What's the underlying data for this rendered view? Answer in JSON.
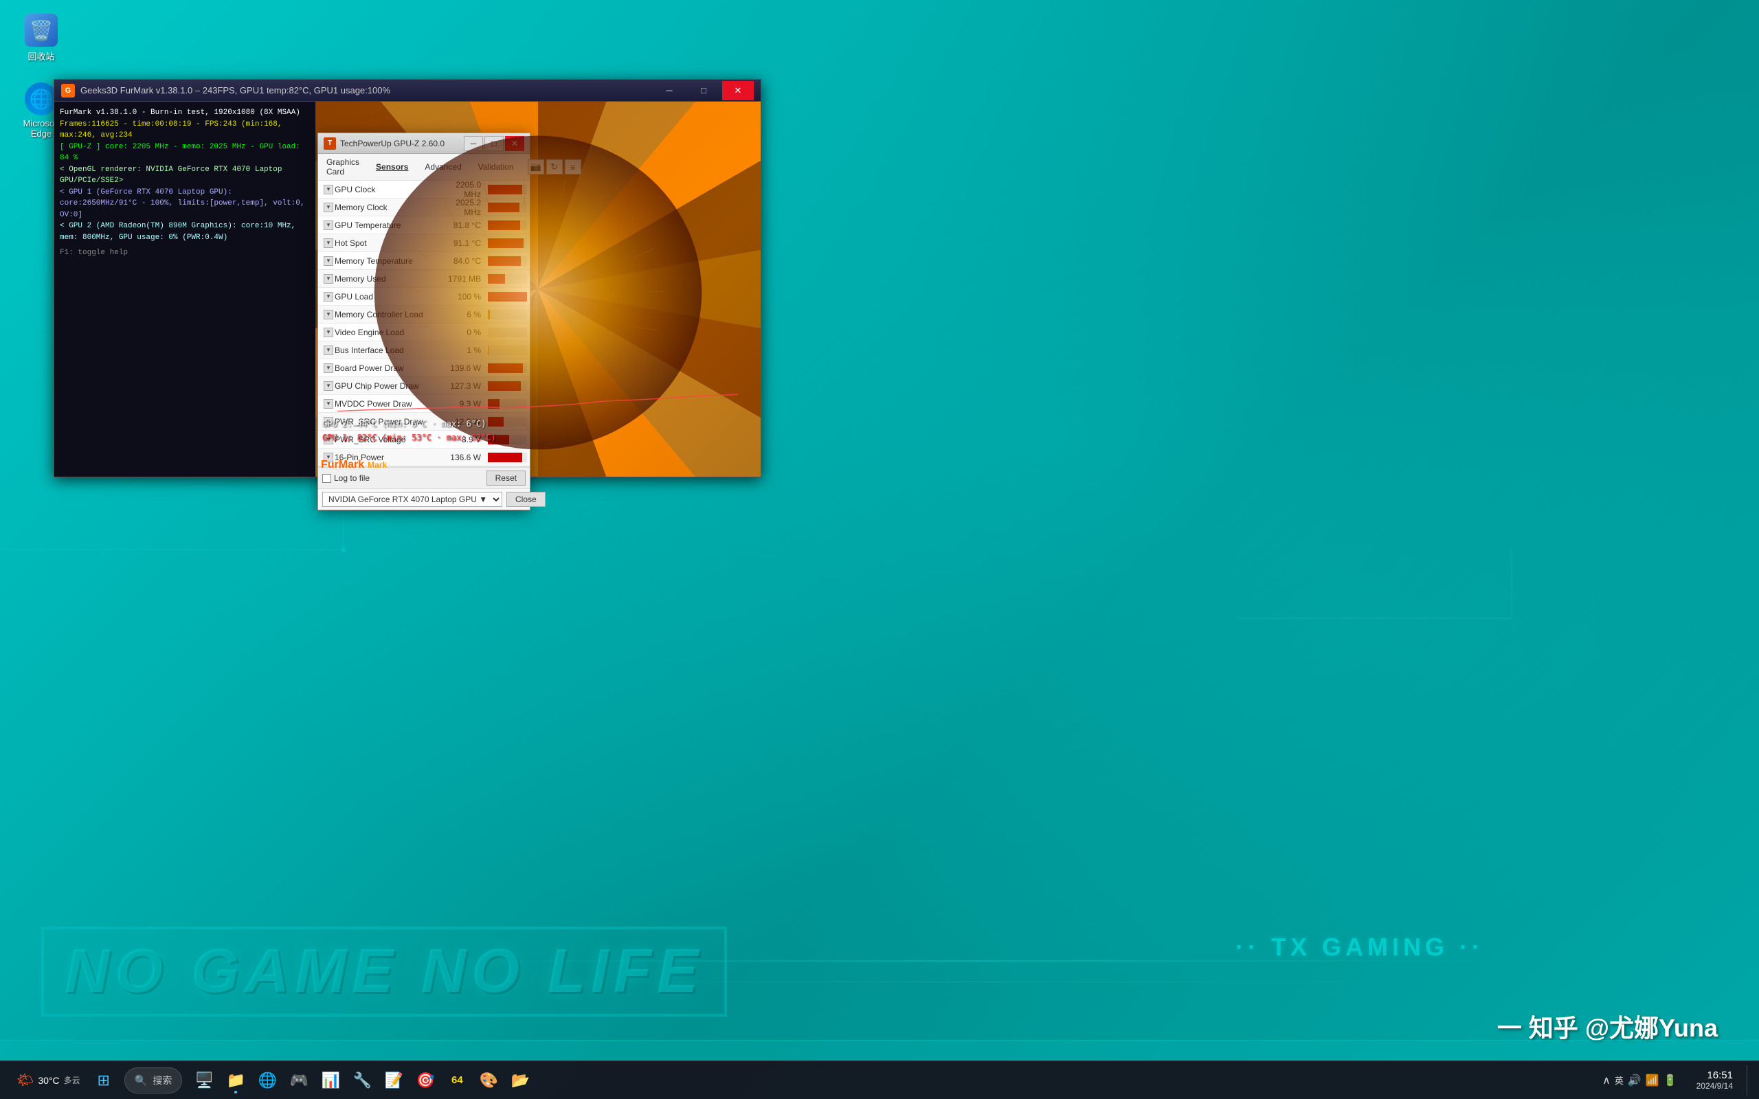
{
  "desktop": {
    "icons": [
      {
        "name": "回收站",
        "emoji": "🗑️"
      },
      {
        "name": "Microsoft Edge",
        "emoji": "🌐"
      }
    ],
    "ngno_text": "NO GAME NO LIFE",
    "tx_gaming": "·· TX GAMING ··",
    "zhihu_mark": "一 知乎 @尤娜Yuna"
  },
  "furmark_window": {
    "title": "Geeks3D FurMark v1.38.1.0 – 243FPS, GPU1 temp:82°C, GPU1 usage:100%",
    "icon": "G",
    "text_lines": [
      "FurMark v1.38.1.0 - Burn-in test, 1920x1080 (8X MSAA)",
      "Frames:116625 - time:00:08:19 - FPS:243 (min:168, max:246, avg:234",
      "[ GPU-Z ] core: 2205 MHz - memo: 2025 MHz - GPU load: 84 %",
      "< OpenGL renderer: NVIDIA GeForce RTX 4070 Laptop GPU/PCIe/SSE2>",
      "< GPU 1 (GeForce RTX 4070 Laptop GPU): core:2650MHz/91°C - 100%, limits:[power,temp], volt:0, OV:0]",
      "< GPU 2 (AMD Radeon(TM) 890M Graphics): core:10 MHz, mem: 800MHz, GPU usage: 0% (PWR:0.4W)"
    ],
    "overlay_text": "GPU 2: 44°C (min: 6°C · max: 6°C)",
    "overlay_text2": "GPU 1: 82°C (min: 53°C · max: 82°C)",
    "logo": "FurMark"
  },
  "gpuz_window": {
    "title": "TechPowerUp GPU-Z 2.60.0",
    "icon": "T",
    "menu_items": [
      "Graphics Card",
      "Sensors",
      "Advanced",
      "Validation"
    ],
    "sensors": [
      {
        "name": "GPU Clock",
        "value": "2205.0 MHz",
        "bar_pct": 88
      },
      {
        "name": "Memory Clock",
        "value": "2025.2 MHz",
        "bar_pct": 81
      },
      {
        "name": "GPU Temperature",
        "value": "81.8 °C",
        "bar_pct": 82
      },
      {
        "name": "Hot Spot",
        "value": "91.1 °C",
        "bar_pct": 91
      },
      {
        "name": "Memory Temperature",
        "value": "84.0 °C",
        "bar_pct": 84
      },
      {
        "name": "Memory Used",
        "value": "1791 MB",
        "bar_pct": 44
      },
      {
        "name": "GPU Load",
        "value": "100 %",
        "bar_pct": 100
      },
      {
        "name": "Memory Controller Load",
        "value": "6 %",
        "bar_pct": 6
      },
      {
        "name": "Video Engine Load",
        "value": "0 %",
        "bar_pct": 0
      },
      {
        "name": "Bus Interface Load",
        "value": "1 %",
        "bar_pct": 1
      },
      {
        "name": "Board Power Draw",
        "value": "139.6 W",
        "bar_pct": 90
      },
      {
        "name": "GPU Chip Power Draw",
        "value": "127.3 W",
        "bar_pct": 85
      },
      {
        "name": "MVDDC Power Draw",
        "value": "9.3 W",
        "bar_pct": 30
      },
      {
        "name": "PWR_SRC Power Draw",
        "value": "12.3 W",
        "bar_pct": 40
      },
      {
        "name": "PWR_SRC Voltage",
        "value": "8.9 V",
        "bar_pct": 55
      },
      {
        "name": "16-Pin Power",
        "value": "136.6 W",
        "bar_pct": 88
      }
    ],
    "log_label": "Log to file",
    "reset_label": "Reset",
    "device_name": "NVIDIA GeForce RTX 4070 Laptop GPU",
    "close_label": "Close"
  },
  "taskbar": {
    "search_placeholder": "搜索",
    "apps": [
      {
        "name": "File Explorer",
        "emoji": "📁"
      },
      {
        "name": "Microsoft Edge",
        "emoji": "🌐"
      },
      {
        "name": "App1",
        "emoji": "🎮"
      },
      {
        "name": "App2",
        "emoji": "📊"
      },
      {
        "name": "App3",
        "emoji": "🔧"
      },
      {
        "name": "App4",
        "emoji": "📝"
      },
      {
        "name": "App5",
        "emoji": "🎯"
      },
      {
        "name": "App6",
        "emoji": "64"
      },
      {
        "name": "App7",
        "emoji": "🎨"
      },
      {
        "name": "App8",
        "emoji": "📂"
      }
    ],
    "clock": {
      "time": "16:51",
      "date": "2024/9/14"
    },
    "weather": {
      "emoji": "🌤",
      "temp": "30°C",
      "desc": "多云"
    },
    "systray": [
      "🔊",
      "📶",
      "🔋",
      "∧"
    ]
  }
}
